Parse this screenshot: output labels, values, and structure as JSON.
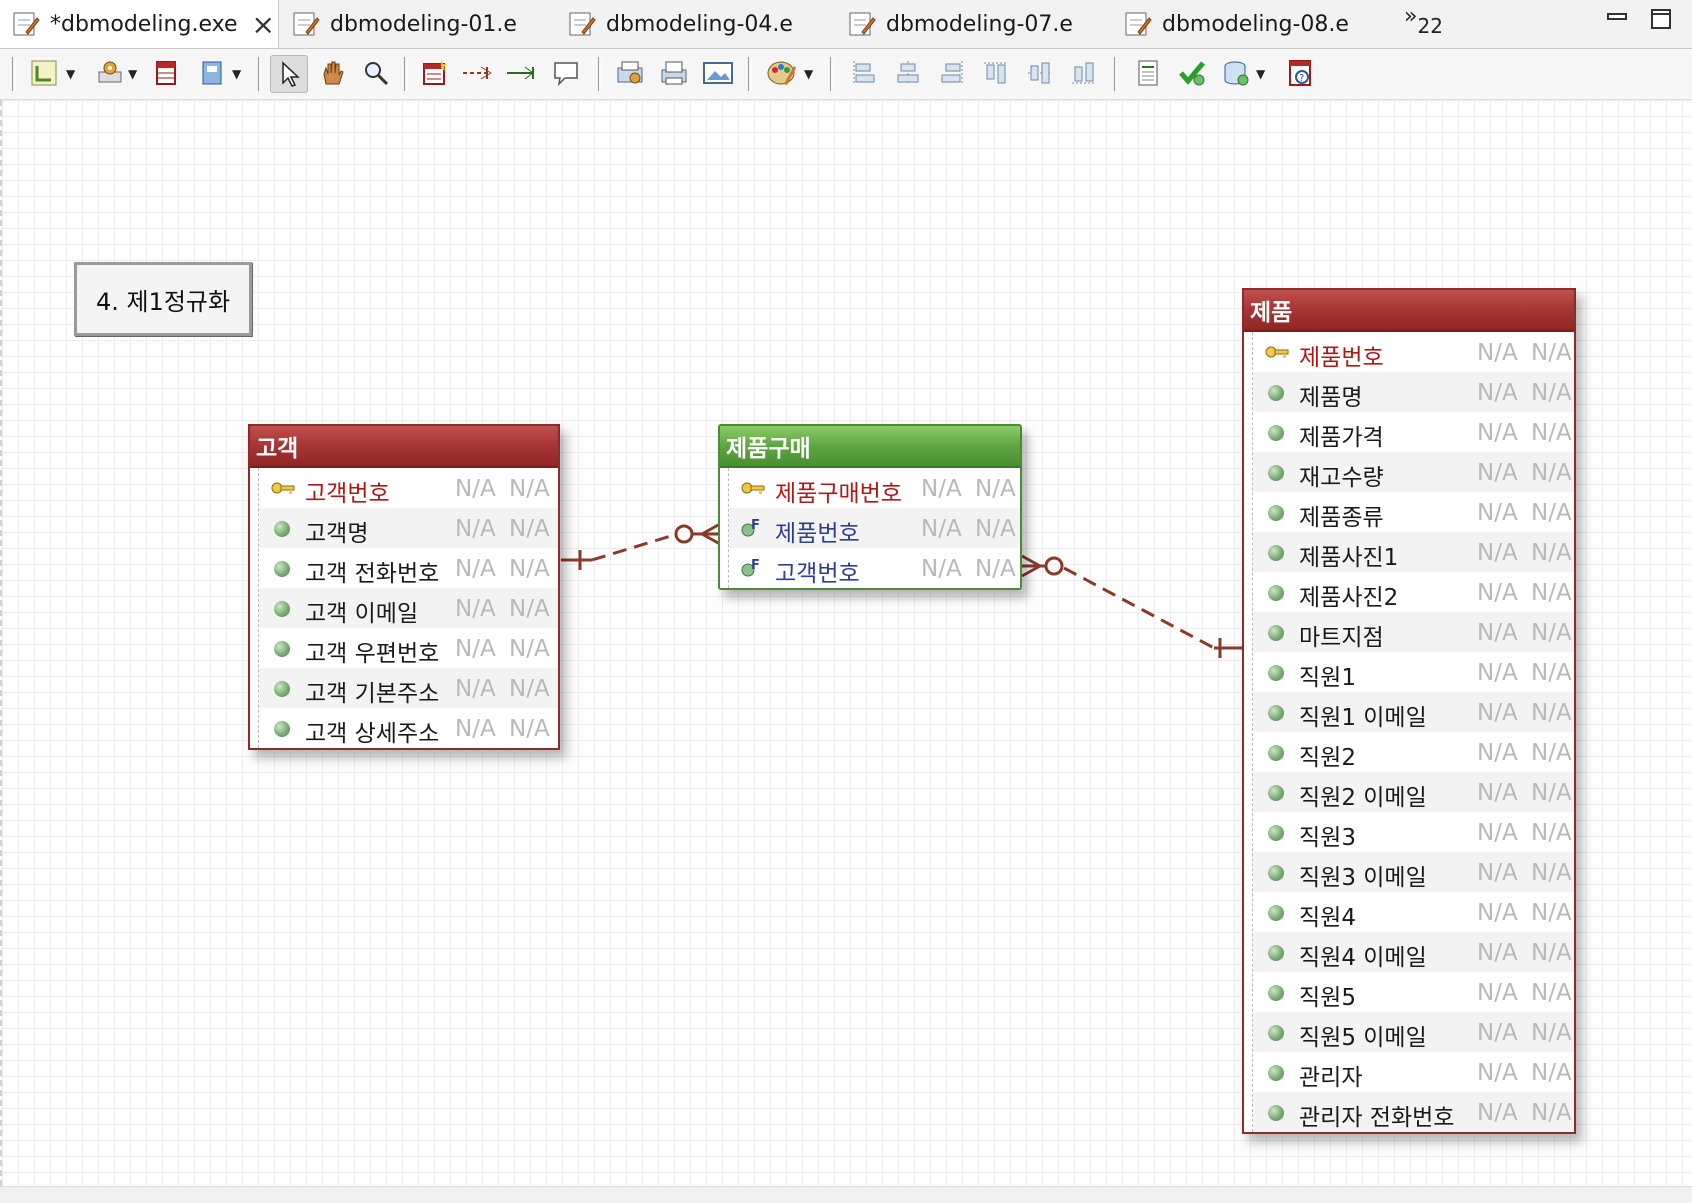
{
  "tabs": [
    {
      "label": "*dbmodeling.exe",
      "active": true,
      "close": "×"
    },
    {
      "label": "dbmodeling-01.e"
    },
    {
      "label": "dbmodeling-04.e"
    },
    {
      "label": "dbmodeling-07.e"
    },
    {
      "label": "dbmodeling-08.e"
    }
  ],
  "tab_overflow": {
    "chevron": "»",
    "count": "22"
  },
  "toolbar": {
    "icons": [
      "layout-icon",
      "settings-icon",
      "table-icon",
      "notebook-icon",
      "select-arrow-icon",
      "hand-icon",
      "zoom-icon",
      "new-entity-icon",
      "relation-dashed-icon",
      "relation-solid-icon",
      "comment-icon",
      "export-icon",
      "print-icon",
      "image-icon",
      "palette-icon",
      "align-left-icon",
      "align-center-icon",
      "align-right-icon",
      "align-top-icon",
      "align-middle-icon",
      "align-bottom-icon",
      "report-icon",
      "validate-icon",
      "database-icon",
      "help-icon"
    ]
  },
  "note": {
    "text": "4. 제1정규화"
  },
  "entities": {
    "customer": {
      "title": "고객",
      "rows": [
        {
          "name": "고객번호",
          "kind": "pk",
          "c1": "N/A",
          "c2": "N/A"
        },
        {
          "name": "고객명",
          "kind": "attr",
          "c1": "N/A",
          "c2": "N/A"
        },
        {
          "name": "고객 전화번호",
          "kind": "attr",
          "c1": "N/A",
          "c2": "N/A"
        },
        {
          "name": "고객 이메일",
          "kind": "attr",
          "c1": "N/A",
          "c2": "N/A"
        },
        {
          "name": "고객 우편번호",
          "kind": "attr",
          "c1": "N/A",
          "c2": "N/A"
        },
        {
          "name": "고객 기본주소",
          "kind": "attr",
          "c1": "N/A",
          "c2": "N/A"
        },
        {
          "name": "고객 상세주소",
          "kind": "attr",
          "c1": "N/A",
          "c2": "N/A"
        }
      ]
    },
    "purchase": {
      "title": "제품구매",
      "rows": [
        {
          "name": "제품구매번호",
          "kind": "pk",
          "c1": "N/A",
          "c2": "N/A"
        },
        {
          "name": "제품번호",
          "kind": "fk",
          "c1": "N/A",
          "c2": "N/A"
        },
        {
          "name": "고객번호",
          "kind": "fk",
          "c1": "N/A",
          "c2": "N/A"
        }
      ]
    },
    "product": {
      "title": "제품",
      "rows": [
        {
          "name": "제품번호",
          "kind": "pk",
          "c1": "N/A",
          "c2": "N/A"
        },
        {
          "name": "제품명",
          "kind": "attr",
          "c1": "N/A",
          "c2": "N/A"
        },
        {
          "name": "제품가격",
          "kind": "attr",
          "c1": "N/A",
          "c2": "N/A"
        },
        {
          "name": "재고수량",
          "kind": "attr",
          "c1": "N/A",
          "c2": "N/A"
        },
        {
          "name": "제품종류",
          "kind": "attr",
          "c1": "N/A",
          "c2": "N/A"
        },
        {
          "name": "제품사진1",
          "kind": "attr",
          "c1": "N/A",
          "c2": "N/A"
        },
        {
          "name": "제품사진2",
          "kind": "attr",
          "c1": "N/A",
          "c2": "N/A"
        },
        {
          "name": "마트지점",
          "kind": "attr",
          "c1": "N/A",
          "c2": "N/A"
        },
        {
          "name": "직원1",
          "kind": "attr",
          "c1": "N/A",
          "c2": "N/A"
        },
        {
          "name": "직원1 이메일",
          "kind": "attr",
          "c1": "N/A",
          "c2": "N/A"
        },
        {
          "name": "직원2",
          "kind": "attr",
          "c1": "N/A",
          "c2": "N/A"
        },
        {
          "name": "직원2 이메일",
          "kind": "attr",
          "c1": "N/A",
          "c2": "N/A"
        },
        {
          "name": "직원3",
          "kind": "attr",
          "c1": "N/A",
          "c2": "N/A"
        },
        {
          "name": "직원3 이메일",
          "kind": "attr",
          "c1": "N/A",
          "c2": "N/A"
        },
        {
          "name": "직원4",
          "kind": "attr",
          "c1": "N/A",
          "c2": "N/A"
        },
        {
          "name": "직원4 이메일",
          "kind": "attr",
          "c1": "N/A",
          "c2": "N/A"
        },
        {
          "name": "직원5",
          "kind": "attr",
          "c1": "N/A",
          "c2": "N/A"
        },
        {
          "name": "직원5 이메일",
          "kind": "attr",
          "c1": "N/A",
          "c2": "N/A"
        },
        {
          "name": "관리자",
          "kind": "attr",
          "c1": "N/A",
          "c2": "N/A"
        },
        {
          "name": "관리자 전화번호",
          "kind": "attr",
          "c1": "N/A",
          "c2": "N/A"
        }
      ]
    }
  },
  "colors": {
    "entity_red": "#a53634",
    "entity_green": "#5ea542",
    "relation": "#8a3a2a",
    "pk_text": "#b01818",
    "fk_text": "#2e3f8f"
  }
}
